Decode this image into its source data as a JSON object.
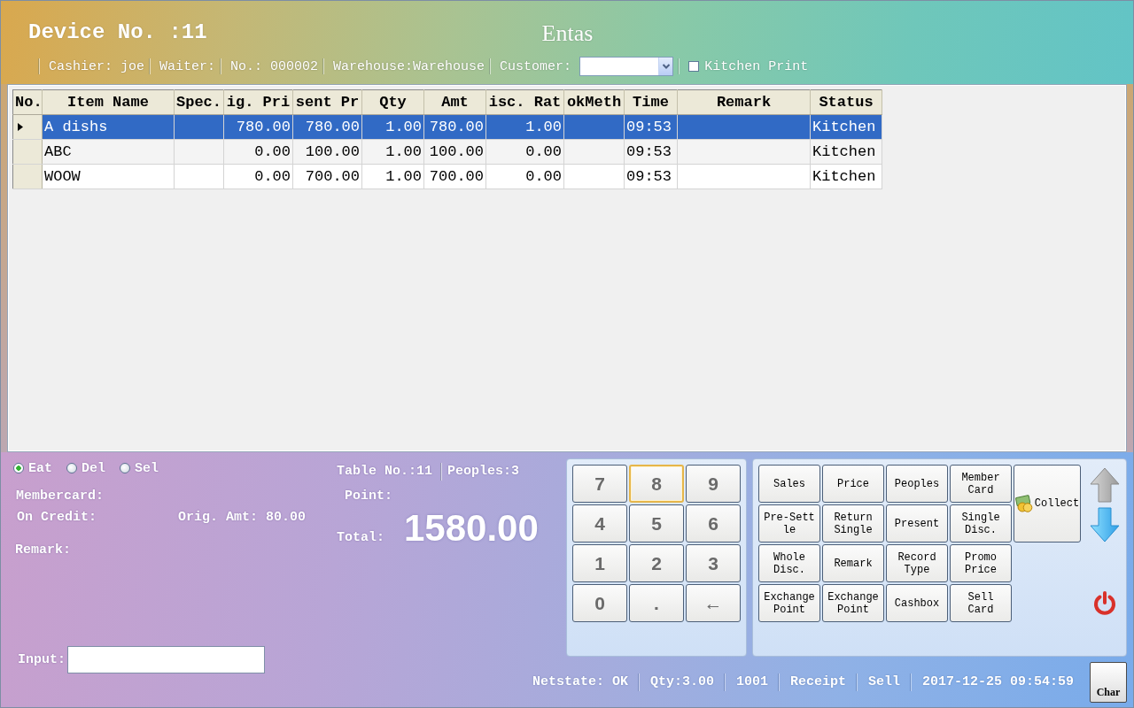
{
  "header": {
    "device": "Device No. :11",
    "title": "Entas"
  },
  "info_bar": {
    "fields": [
      "Cashier: joe",
      "Waiter:",
      "No.: 000002",
      "Warehouse:Warehouse"
    ],
    "customer": {
      "label": "Customer:"
    },
    "kitchen_print": {
      "label": "Kitchen Print",
      "checked": false
    }
  },
  "table": {
    "columns": [
      "No.",
      "Item Name",
      "Spec.",
      "ig. Pri",
      "sent Pr",
      "Qty",
      "Amt",
      "isc. Rat",
      "okMeth",
      "Time",
      "Remark",
      "Status"
    ],
    "rows": [
      {
        "selected": true,
        "cells": [
          "",
          "A dishs",
          "",
          "780.00",
          "780.00",
          "1.00",
          "780.00",
          "1.00",
          "",
          "09:53",
          "",
          "Kitchen"
        ]
      },
      {
        "selected": false,
        "cells": [
          "",
          "ABC",
          "",
          "0.00",
          "100.00",
          "1.00",
          "100.00",
          "0.00",
          "",
          "09:53",
          "",
          "Kitchen"
        ]
      },
      {
        "selected": false,
        "cells": [
          "",
          "WOOW",
          "",
          "0.00",
          "700.00",
          "1.00",
          "700.00",
          "0.00",
          "",
          "09:53",
          "",
          "Kitchen"
        ]
      }
    ]
  },
  "order_type": [
    {
      "label": "Eat",
      "selected": true
    },
    {
      "label": "Del",
      "selected": false
    },
    {
      "label": "Sel",
      "selected": false
    }
  ],
  "details": {
    "membercard": "Membercard:",
    "on_credit": "On Credit:",
    "orig_amt": "Orig. Amt: 80.00",
    "remark": "Remark:",
    "table_no": "Table No.:11",
    "peoples": "Peoples:3",
    "point": "Point:",
    "total_label": "Total:",
    "total": "1580.00"
  },
  "input": {
    "label": "Input:"
  },
  "numpad": [
    {
      "label": "7",
      "focused": false
    },
    {
      "label": "8",
      "focused": true
    },
    {
      "label": "9",
      "focused": false
    },
    {
      "label": "4",
      "focused": false
    },
    {
      "label": "5",
      "focused": false
    },
    {
      "label": "6",
      "focused": false
    },
    {
      "label": "1",
      "focused": false
    },
    {
      "label": "2",
      "focused": false
    },
    {
      "label": "3",
      "focused": false
    },
    {
      "label": "0",
      "focused": false
    },
    {
      "label": ".",
      "focused": false
    },
    {
      "label": "←",
      "focused": false
    }
  ],
  "functions": [
    {
      "lines": [
        "Sales"
      ]
    },
    {
      "lines": [
        "Price"
      ]
    },
    {
      "lines": [
        "Peoples"
      ]
    },
    {
      "lines": [
        "Member",
        "Card"
      ]
    },
    {
      "lines": [
        "Pre-Sett",
        "le"
      ]
    },
    {
      "lines": [
        "Return",
        "Single"
      ]
    },
    {
      "lines": [
        "Present"
      ]
    },
    {
      "lines": [
        "Single",
        "Disc."
      ]
    },
    {
      "lines": [
        "Whole",
        "Disc."
      ]
    },
    {
      "lines": [
        "Remark"
      ]
    },
    {
      "lines": [
        "Record",
        "Type"
      ]
    },
    {
      "lines": [
        "Promo",
        "Price"
      ]
    },
    {
      "lines": [
        "Exchange",
        "Point"
      ]
    },
    {
      "lines": [
        "Exchange",
        "Point"
      ]
    },
    {
      "lines": [
        "Cashbox"
      ]
    },
    {
      "lines": [
        "Sell",
        "Card"
      ]
    }
  ],
  "collect": {
    "label": "Collect"
  },
  "status_bar": {
    "items": [
      "Netstate: OK",
      "Qty:3.00",
      "1001",
      "Receipt",
      "Sell",
      "2017-12-25 09:54:59"
    ],
    "char_button": "Char"
  }
}
